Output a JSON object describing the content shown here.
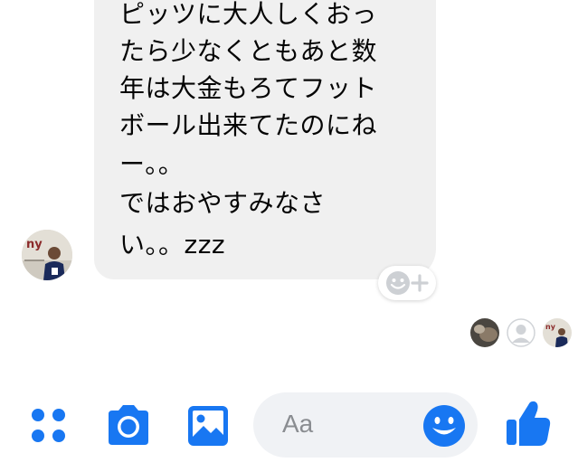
{
  "message": {
    "lines": [
      "ピッツに大人しくおっ",
      "たら少なくともあと数",
      "年は大金もろてフット",
      "ボール出来てたのにね",
      "ー。。",
      "ではおやすみなさ",
      "い。。zzz"
    ]
  },
  "sender": {
    "avatar_logo": "ny"
  },
  "composer": {
    "placeholder": "Aa",
    "icons": {
      "apps": "four-dots-icon",
      "camera": "camera-icon",
      "gallery": "image-icon",
      "emoji": "smiley-icon",
      "like": "thumbs-up-icon"
    }
  },
  "colors": {
    "accent": "#1877f2",
    "bubble": "#f0f0f0"
  }
}
